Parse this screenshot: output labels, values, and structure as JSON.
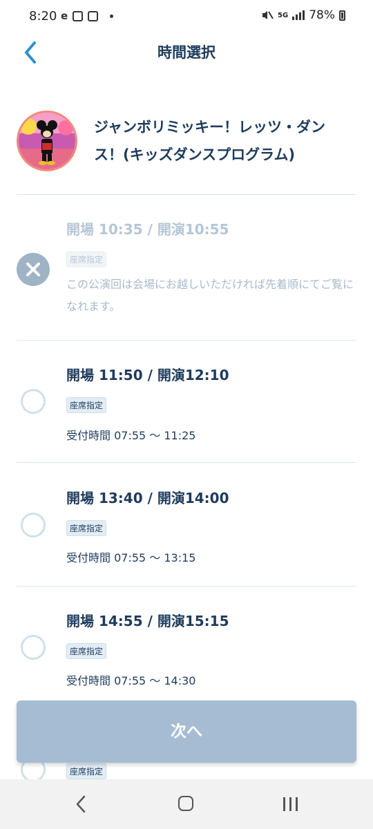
{
  "status_bar": {
    "time": "8:20",
    "network": "5G",
    "battery": "78%"
  },
  "header": {
    "title": "時間選択"
  },
  "show": {
    "title": "ジャンボリミッキー！レッツ・ダンス！(キッズダンスプログラム)"
  },
  "slots": [
    {
      "time": "開場 10:35 / 開演10:55",
      "badge": "座席指定",
      "note": "この公演回は会場にお越しいただければ先着順にてご覧になれます。",
      "available": false
    },
    {
      "time": "開場 11:50 / 開演12:10",
      "badge": "座席指定",
      "reception": "受付時間 07:55 ～ 11:25",
      "available": true
    },
    {
      "time": "開場 13:40 / 開演14:00",
      "badge": "座席指定",
      "reception": "受付時間 07:55 ～ 13:15",
      "available": true
    },
    {
      "time": "開場 14:55 / 開演15:15",
      "badge": "座席指定",
      "reception": "受付時間 07:55 ～ 14:30",
      "available": true
    },
    {
      "badge": "座席指定"
    }
  ],
  "next_button": {
    "label": "次へ"
  },
  "colors": {
    "primary": "#1d3b5c",
    "accent": "#2f8fd0",
    "button_disabled": "#a5bcd2",
    "avatar_border": "#f08b7d"
  }
}
